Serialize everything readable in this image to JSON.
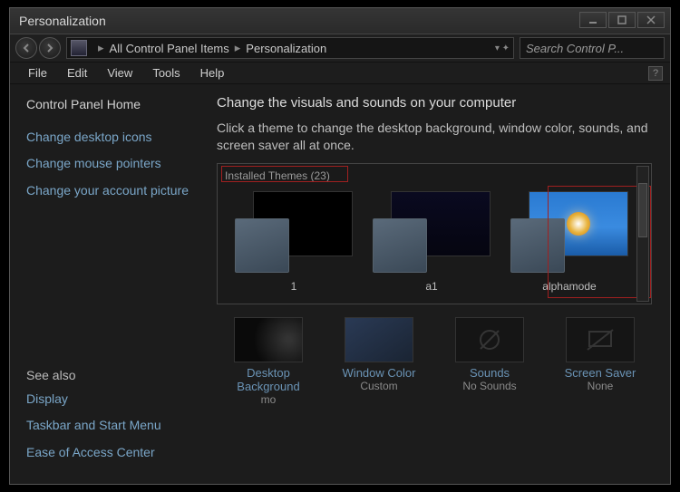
{
  "window": {
    "title": "Personalization"
  },
  "breadcrumb": {
    "level1": "All Control Panel Items",
    "level2": "Personalization"
  },
  "search": {
    "placeholder": "Search Control P..."
  },
  "menu": {
    "file": "File",
    "edit": "Edit",
    "view": "View",
    "tools": "Tools",
    "help": "Help"
  },
  "sidebar": {
    "home": "Control Panel Home",
    "links": [
      "Change desktop icons",
      "Change mouse pointers",
      "Change your account picture"
    ],
    "seealso_label": "See also",
    "seealso": [
      "Display",
      "Taskbar and Start Menu",
      "Ease of Access Center"
    ]
  },
  "main": {
    "heading": "Change the visuals and sounds on your computer",
    "description": "Click a theme to change the desktop background, window color, sounds, and screen saver all at once.",
    "group_label": "Installed Themes (23)",
    "themes": [
      {
        "name": "1"
      },
      {
        "name": "a1"
      },
      {
        "name": "alphamode"
      }
    ],
    "bottom": {
      "desktop_bg": {
        "label": "Desktop Background",
        "sub": "mo"
      },
      "window_color": {
        "label": "Window Color",
        "sub": "Custom"
      },
      "sounds": {
        "label": "Sounds",
        "sub": "No Sounds"
      },
      "screen_saver": {
        "label": "Screen Saver",
        "sub": "None"
      }
    }
  }
}
